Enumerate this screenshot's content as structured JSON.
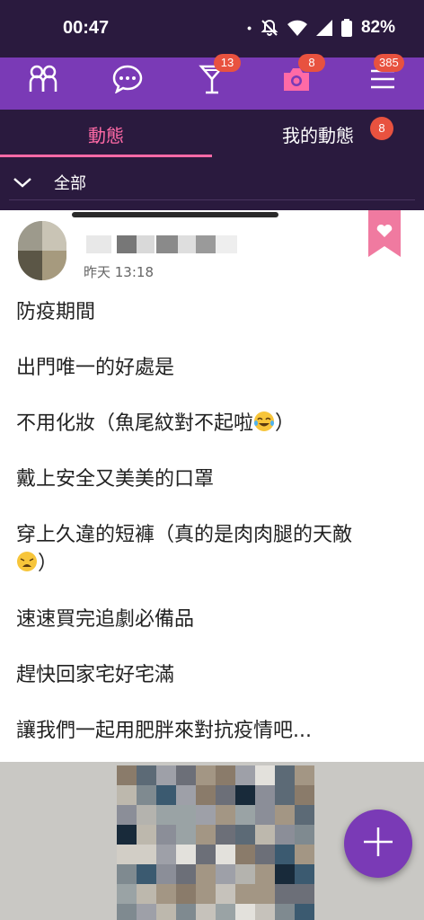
{
  "status_bar": {
    "time": "00:47",
    "dot": "•",
    "battery": "82%",
    "icons": [
      "notification-dot",
      "bell-off-icon",
      "wifi-icon",
      "signal-icon",
      "battery-icon"
    ]
  },
  "nav": {
    "items": [
      {
        "name": "friends",
        "icon": "people-icon",
        "badge": ""
      },
      {
        "name": "chat",
        "icon": "chat-bubble-icon",
        "badge": ""
      },
      {
        "name": "party",
        "icon": "cocktail-icon",
        "badge": "13"
      },
      {
        "name": "photos",
        "icon": "camera-icon",
        "badge": "8"
      },
      {
        "name": "menu",
        "icon": "hamburger-menu-icon",
        "badge": "385"
      }
    ],
    "active_color": "#ff6aa6"
  },
  "tabs": {
    "active_label": "動態",
    "other_label": "我的動態",
    "other_badge": "8"
  },
  "filter": {
    "label": "全部",
    "icon": "chevron-down-icon"
  },
  "post": {
    "time": "昨天 13:18",
    "like_icon": "heart-icon",
    "lines": [
      "防疫期間",
      "出門唯一的好處是",
      "不用化妝（魚尾紋對不起啦",
      "戴上安全又美美的口罩",
      "穿上久違的短褲（真的是肉肉腿的天敵",
      "速速買完追劇必備品",
      "趕快回家宅好宅滿",
      "讓我們一起用肥胖來對抗疫情吧..."
    ],
    "line3_suffix": "）",
    "line5_suffix": "）",
    "emojis": [
      "tears-of-joy-emoji",
      "weary-face-emoji"
    ]
  },
  "fab": {
    "icon": "plus-icon"
  },
  "colors": {
    "brand_purple": "#7a3ab6",
    "dark_bg": "#2a1a3e",
    "badge_red": "#e8523f",
    "ribbon_pink": "#f07aa0"
  }
}
